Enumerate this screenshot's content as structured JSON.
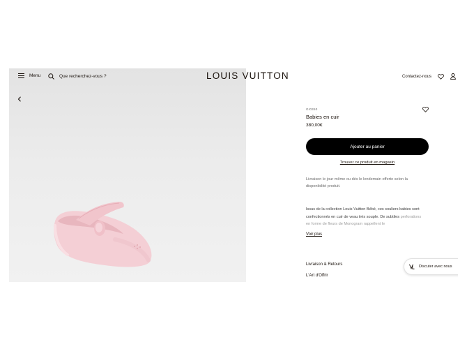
{
  "header": {
    "menu_label": "Menu",
    "search_label": "Que recherchez-vous ?",
    "logo": "LOUIS VUITTON",
    "contact_label": "Contactez-nous"
  },
  "product": {
    "sku": "GI0350",
    "title": "Babies en cuir",
    "price": "380,00€",
    "add_to_cart": "Ajouter au panier",
    "find_in_store": "Trouver ce produit en magasin",
    "delivery_info": "Livraison le jour même ou dès le lendemain offerte selon la disponibilité produit.",
    "description_visible": "Issus de la collection Louis Vuitton Bébé, ces souliers babies sont confectionnés en cuir de veau très souple. De subtiles",
    "description_faded": "perforations en forme de fleurs de Monogram rappellent le",
    "see_more": "Voir plus",
    "delivery_returns": "Livraison & Retours",
    "art_of_gifting": "L'Art d'Offrir",
    "shoe_color": "#f3cdd3"
  },
  "chat": {
    "label": "Discuter avec nous"
  },
  "icons": {
    "menu": "menu-icon",
    "search": "search-icon",
    "wishlist": "heart-icon",
    "account": "user-icon",
    "back": "chevron-left-icon",
    "chat": "chat-monogram-icon"
  }
}
